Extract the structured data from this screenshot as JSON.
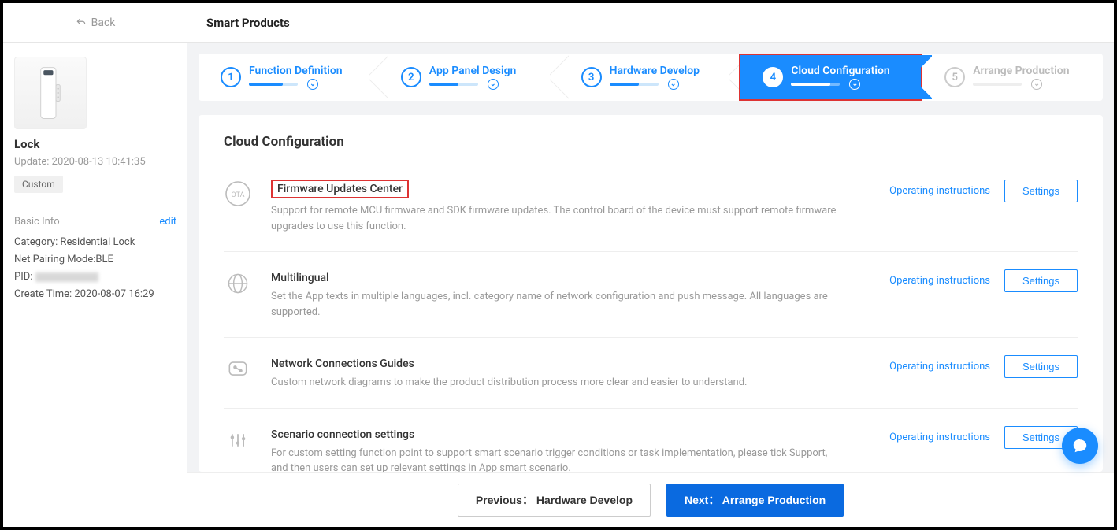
{
  "topbar": {
    "back_label": "Back",
    "title": "Smart Products"
  },
  "product": {
    "name": "Lock",
    "update_label": "Update: 2020-08-13 10:41:35",
    "badge": "Custom"
  },
  "basic_info": {
    "header": "Basic Info",
    "edit": "edit",
    "category": "Category: Residential Lock",
    "pairing": "Net Pairing Mode:BLE",
    "pid_label": "PID:",
    "create_time": "Create Time: 2020-08-07 16:29"
  },
  "steps": [
    {
      "num": "1",
      "label": "Function Definition",
      "state": "done"
    },
    {
      "num": "2",
      "label": "App Panel Design",
      "state": "done"
    },
    {
      "num": "3",
      "label": "Hardware Develop",
      "state": "done"
    },
    {
      "num": "4",
      "label": "Cloud Configuration",
      "state": "active"
    },
    {
      "num": "5",
      "label": "Arrange Production",
      "state": "inactive"
    }
  ],
  "page": {
    "title": "Cloud Configuration",
    "link_label": "Operating instructions",
    "btn_label": "Settings",
    "items": [
      {
        "title": "Firmware Updates Center",
        "highlighted": true,
        "desc": "Support for remote MCU firmware and SDK firmware updates. The control board of the device must support remote firmware upgrades to use this function."
      },
      {
        "title": "Multilingual",
        "desc": "Set the App texts in multiple languages, incl. category name of network configuration and push message. All languages are supported."
      },
      {
        "title": "Network Connections Guides",
        "desc": "Custom network diagrams to make the product distribution process more clear and easier to understand."
      },
      {
        "title": "Scenario connection settings",
        "desc": "For custom setting function point to support smart scenario trigger conditions or task implementation, please tick Support, and then users can set up relevant settings in App smart scenario."
      }
    ]
  },
  "footer": {
    "prev": "Previous： Hardware Develop",
    "next": "Next： Arrange Production"
  }
}
